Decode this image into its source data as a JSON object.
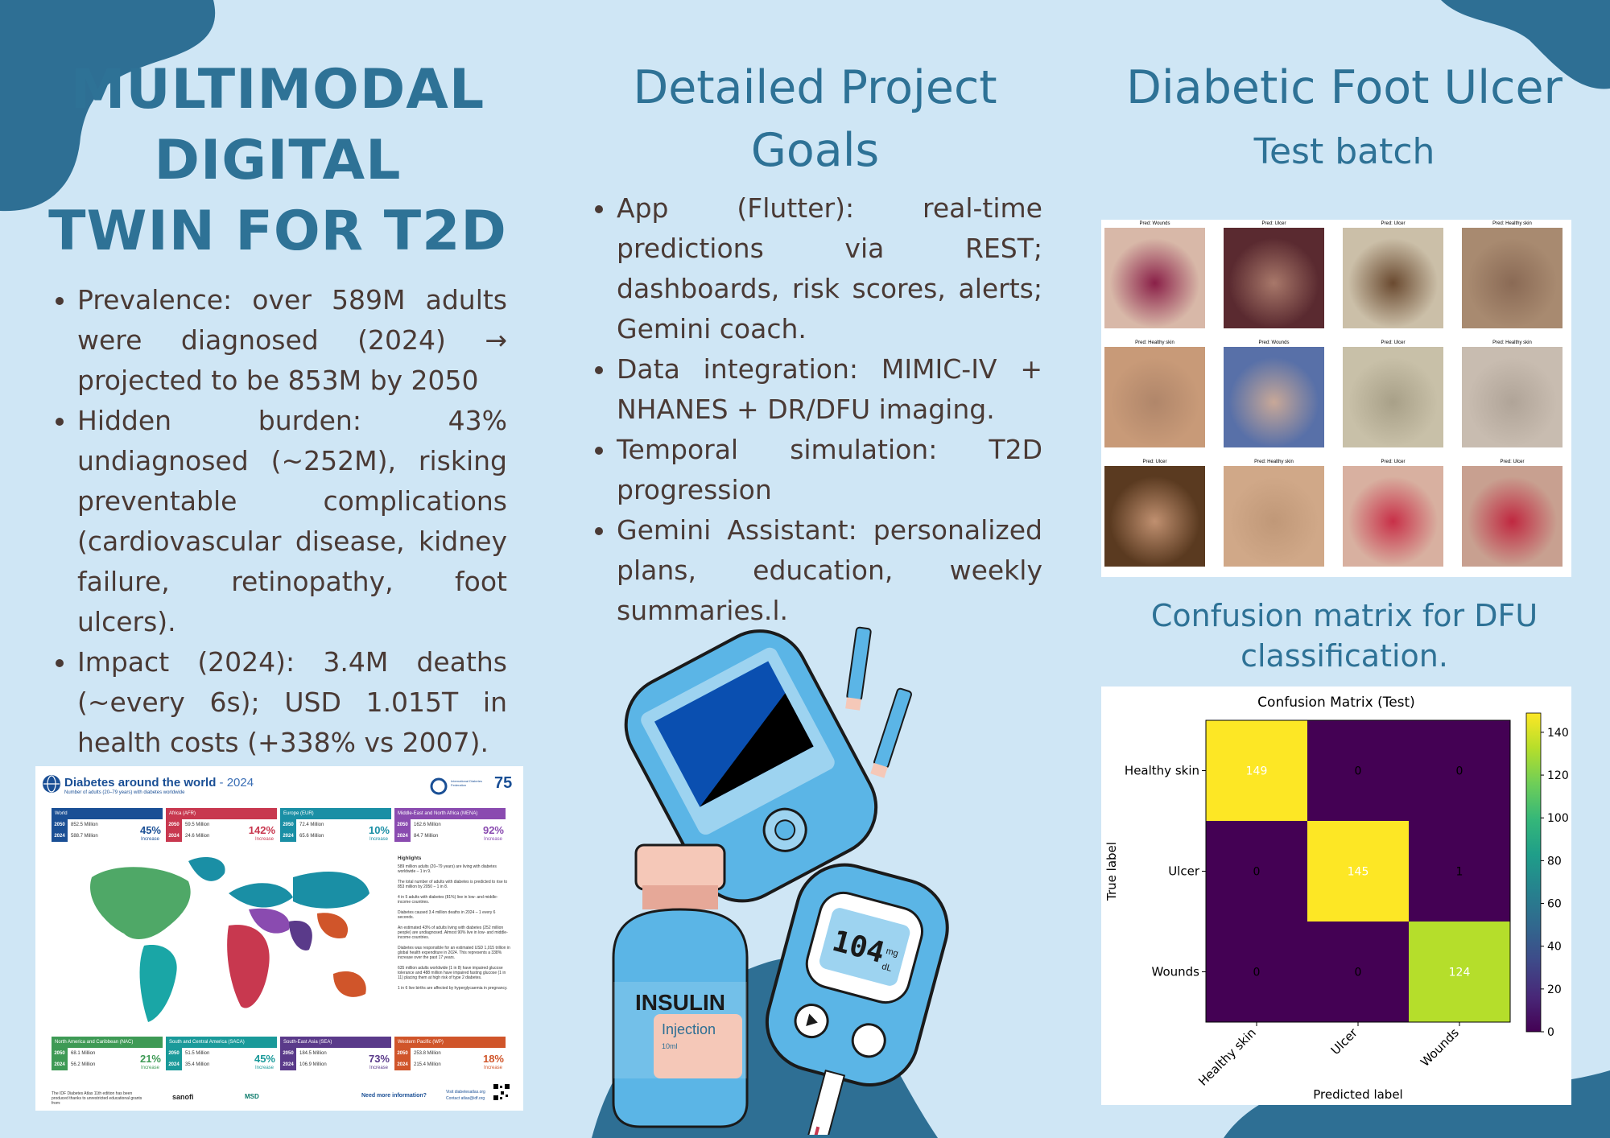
{
  "poster": {
    "title_lines": [
      "MULTIMODAL",
      "DIGITAL",
      "TWIN FOR T2D"
    ],
    "left_bullets": [
      "Prevalence: over 589M adults were diagnosed (2024) → projected to be 853M by 2050",
      "Hidden burden: 43% undiagnosed (~252M), risking preventable complications (cardiovascular disease, kidney failure, retinopathy, foot ulcers).",
      "Impact (2024): 3.4M deaths (~every 6s); USD 1.015T in health costs (+338% vs 2007)."
    ],
    "goals_title_lines": [
      "Detailed Project",
      "Goals"
    ],
    "goals_bullets": [
      "App (Flutter): real-time predictions via REST; dashboards, risk scores, alerts; Gemini coach.",
      "Data integration: MIMIC-IV + NHANES + DR/DFU imaging.",
      "Temporal simulation: T2D progression",
      "Gemini Assistant: personalized plans, education, weekly summaries.l."
    ],
    "dfu_title": "Diabetic Foot Ulcer",
    "test_batch_title": "Test batch",
    "confusion_caption_lines": [
      "Confusion matrix for DFU",
      "classification."
    ]
  },
  "illustration": {
    "bottle_label": "INSULIN",
    "bottle_sub": "Injection",
    "bottle_vol": "10ml",
    "meter_reading": "104",
    "meter_unit_top": "mg",
    "meter_unit_bottom": "dL"
  },
  "world_map": {
    "title": "Diabetes around the world",
    "year": "- 2024",
    "subtitle": "Number of adults (20–79 years) with diabetes worldwide",
    "regions": [
      {
        "name": "World",
        "y2050": "852.5 Million",
        "y2024": "588.7 Million",
        "pct": "45%",
        "color": "#1a4f95"
      },
      {
        "name": "Africa (AFR)",
        "y2050": "59.5 Million",
        "y2024": "24.6 Million",
        "pct": "142%",
        "color": "#c8384f"
      },
      {
        "name": "Europe (EUR)",
        "y2050": "72.4 Million",
        "y2024": "65.6 Million",
        "pct": "10%",
        "color": "#1a8fa5"
      },
      {
        "name": "Middle-East and North Africa (MENA)",
        "y2050": "162.6 Million",
        "y2024": "84.7 Million",
        "pct": "92%",
        "color": "#8a4bb0"
      },
      {
        "name": "North America and Caribbean (NAC)",
        "y2050": "68.1 Million",
        "y2024": "56.2 Million",
        "pct": "21%",
        "color": "#3e9a55"
      },
      {
        "name": "South and Central America (SACA)",
        "y2050": "51.5 Million",
        "y2024": "35.4 Million",
        "pct": "45%",
        "color": "#1a9a9a"
      },
      {
        "name": "South-East Asia (SEA)",
        "y2050": "184.5 Million",
        "y2024": "106.9 Million",
        "pct": "73%",
        "color": "#5a3a8a"
      },
      {
        "name": "Western Pacific (WP)",
        "y2050": "253.8 Million",
        "y2024": "215.4 Million",
        "pct": "18%",
        "color": "#d0552a"
      }
    ],
    "highlights_title": "Highlights",
    "highlights": [
      "589 million adults (20–79 years) are living with diabetes worldwide – 1 in 9.",
      "The total number of adults with diabetes is predicted to rise to 853 million by 2050 – 1 in 8.",
      "4 in 5 adults with diabetes (81%) live in low- and middle-income countries.",
      "Diabetes caused 3.4 million deaths in 2024 – 1 every 6 seconds.",
      "An estimated 43% of adults living with diabetes (252 million people) are undiagnosed. Almost 90% live in low- and middle-income countries.",
      "Diabetes was responsible for an estimated USD 1,015 trillion in global health expenditure in 2024. This represents a 338% increase over the past 17 years.",
      "635 million adults worldwide (1 in 8) have impaired glucose tolerance and 488 million have impaired fasting glucose (1 in 11) placing them at high risk of type 2 diabetes.",
      "1 in 6 live births are affected by hyperglycaemia in pregnancy."
    ],
    "label_2050": "2050",
    "label_2024": "2024",
    "increase": "Increase",
    "footer_left": "The IDF Diabetes Atlas 11th edition has been produced thanks to unrestricted educational grants from:",
    "sponsors": [
      "sanofi",
      "MSD"
    ],
    "need_more": "Need more information?",
    "visit": "Visit diabetesatlas.org",
    "contact": "Contact atlas@idf.org",
    "idf_name": "International Diabetes Federation"
  },
  "test_batch": {
    "labels": [
      "Pred: Wounds",
      "Pred: Ulcer",
      "Pred: Ulcer",
      "Pred: Healthy skin",
      "Pred: Healthy skin",
      "Pred: Wounds",
      "Pred: Ulcer",
      "Pred: Healthy skin",
      "Pred: Ulcer",
      "Pred: Healthy skin",
      "Pred: Ulcer",
      "Pred: Ulcer"
    ]
  },
  "chart_data": {
    "type": "heatmap",
    "title": "Confusion Matrix (Test)",
    "xlabel": "Predicted label",
    "ylabel": "True label",
    "x_categories": [
      "Healthy skin",
      "Ulcer",
      "Wounds"
    ],
    "y_categories": [
      "Healthy skin",
      "Ulcer",
      "Wounds"
    ],
    "values": [
      [
        149,
        0,
        0
      ],
      [
        0,
        145,
        1
      ],
      [
        0,
        0,
        124
      ]
    ],
    "colorbar_ticks": [
      0,
      20,
      40,
      60,
      80,
      100,
      120,
      140
    ],
    "colorbar_range": [
      0,
      149
    ],
    "colormap": "viridis"
  }
}
